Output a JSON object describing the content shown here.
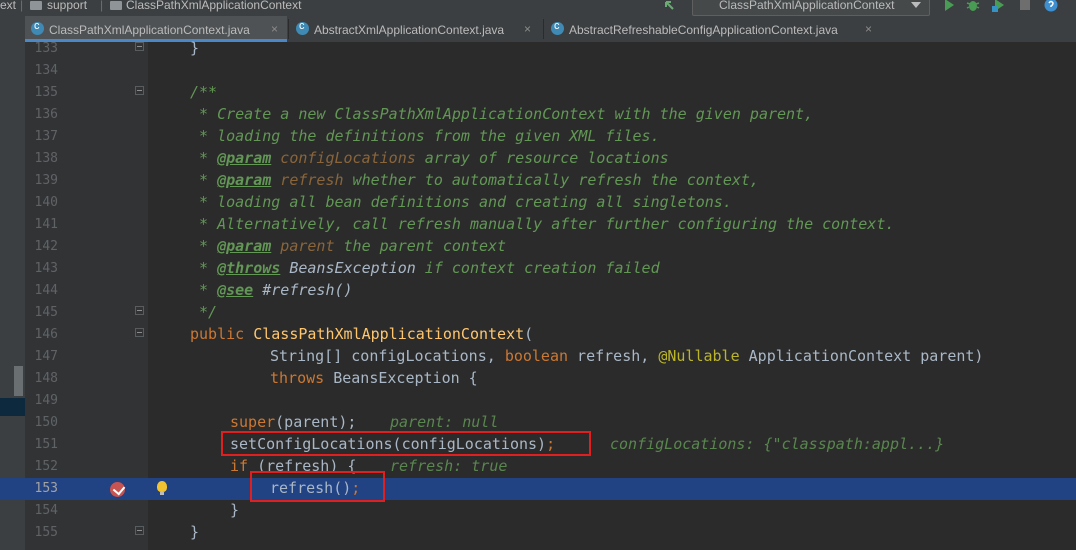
{
  "nav": {
    "crumbs": [
      "ext",
      "support",
      "ClassPathXmlApplicationContext"
    ],
    "run_config": "ClassPathXmlApplicationContext"
  },
  "tabs": [
    {
      "label": "ClassPathXmlApplicationContext.java",
      "active": true
    },
    {
      "label": "AbstractXmlApplicationContext.java",
      "active": false
    },
    {
      "label": "AbstractRefreshableConfigApplicationContext.java",
      "active": false
    }
  ],
  "close_glyph": "×",
  "lines": {
    "n133": "133",
    "n134": "134",
    "n135": "135",
    "n136": "136",
    "n137": "137",
    "n138": "138",
    "n139": "139",
    "n140": "140",
    "n141": "141",
    "n142": "142",
    "n143": "143",
    "n144": "144",
    "n145": "145",
    "n146": "146",
    "n147": "147",
    "n148": "148",
    "n149": "149",
    "n150": "150",
    "n151": "151",
    "n152": "152",
    "n153": "153",
    "n154": "154",
    "n155": "155"
  },
  "code": {
    "l133": "}",
    "l135": "/**",
    "l136": " * Create a new ClassPathXmlApplicationContext with the given parent,",
    "l137": " * loading the definitions from the given XML files.",
    "l138_a": " * ",
    "l138_tag": "@param",
    "l138_p": " configLocations",
    "l138_b": " array of resource locations",
    "l139_a": " * ",
    "l139_tag": "@param",
    "l139_p": " refresh",
    "l139_b": " whether to automatically refresh the context,",
    "l140": " * loading all bean definitions and creating all singletons.",
    "l141": " * Alternatively, call refresh manually after further configuring the context.",
    "l142_a": " * ",
    "l142_tag": "@param",
    "l142_p": " parent",
    "l142_b": " the parent context",
    "l143_a": " * ",
    "l143_tag": "@throws",
    "l143_r": " BeansException",
    "l143_b": " if context creation failed",
    "l144_a": " * ",
    "l144_tag": "@see",
    "l144_r": " #refresh()",
    "l145": " */",
    "l146_kw": "public ",
    "l146_fn": "ClassPathXmlApplicationContext",
    "l146_b": "(",
    "l147_a": "String[] configLocations, ",
    "l147_kw": "boolean",
    "l147_b": " refresh, ",
    "l147_ann": "@Nullable",
    "l147_c": " ApplicationContext parent)",
    "l148_kw": "throws",
    "l148_b": " BeansException {",
    "l150_kw": "super",
    "l150_b": "(parent);",
    "l150_hint": "parent: null",
    "l151_a": "setConfigLocations(configLocations)",
    "l151_semi": ";",
    "l151_hint": "configLocations: {\"classpath:appl...}",
    "l152_kw": "if",
    "l152_b": " (refresh) {",
    "l152_hint": "refresh: true",
    "l153_a": "refresh()",
    "l153_semi": ";",
    "l154": "}",
    "l155": "}"
  },
  "colors": {
    "accent": "#4a88c7",
    "current_line": "#214283",
    "highlight_box": "#e02020",
    "breakpoint": "#c75450"
  },
  "icons": [
    "folder-icon",
    "run-icon",
    "debug-icon",
    "coverage-icon",
    "stop-icon",
    "help-icon",
    "breakpoint-icon",
    "lightbulb-icon"
  ]
}
